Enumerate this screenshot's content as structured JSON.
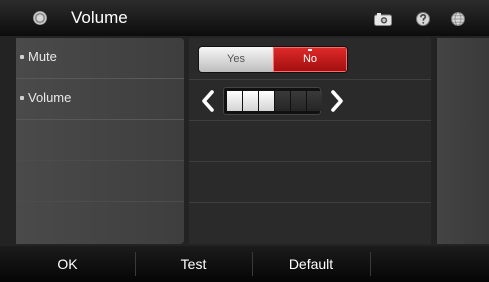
{
  "header": {
    "title": "Volume",
    "icons": [
      "settings-icon",
      "camera-icon",
      "help-icon",
      "globe-icon"
    ]
  },
  "menu": {
    "items": [
      {
        "label": "Mute"
      },
      {
        "label": "Volume"
      }
    ]
  },
  "mute_toggle": {
    "options": [
      "Yes",
      "No"
    ],
    "selected": "No"
  },
  "volume_control": {
    "segments_total": 6,
    "segments_filled": 3,
    "level": 0.5
  },
  "footer": {
    "buttons": [
      "OK",
      "Test",
      "Default"
    ]
  },
  "colors": {
    "accent": "#c81818",
    "background": "#000000"
  }
}
